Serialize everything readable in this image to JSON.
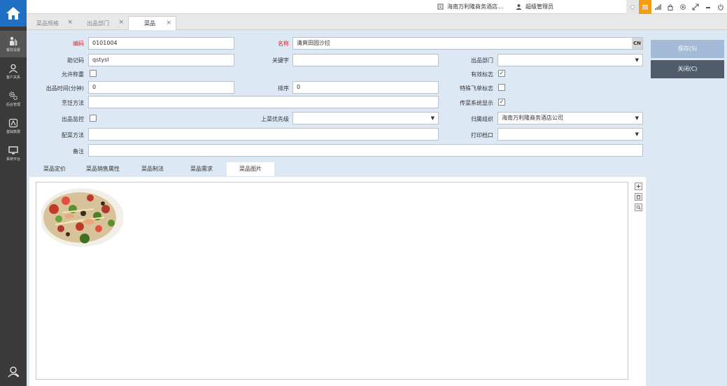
{
  "sidebar": {
    "items": [
      {
        "label": "餐饮设置",
        "icon": "chef-icon"
      },
      {
        "label": "客户关系",
        "icon": "user-icon"
      },
      {
        "label": "后台管理",
        "icon": "gears-icon"
      },
      {
        "label": "基础数据",
        "icon": "database-icon"
      },
      {
        "label": "系统平台",
        "icon": "monitor-icon"
      }
    ]
  },
  "topbar": {
    "hotel": "海南万利隆商务酒店...",
    "user": "超级管理员"
  },
  "tabs": [
    {
      "label": "菜品规格"
    },
    {
      "label": "出品部门"
    },
    {
      "label": "菜品"
    }
  ],
  "form": {
    "code_label": "编码",
    "code_value": "0101004",
    "name_label": "名称",
    "name_value": "清爽田园沙拉",
    "name_badge": "CN",
    "mnemonic_label": "助记码",
    "mnemonic_value": "qstysl",
    "keyword_label": "关键字",
    "keyword_value": "",
    "dept_label": "出品部门",
    "dept_value": "",
    "allow_weigh_label": "允许称重",
    "allow_weigh": false,
    "valid_label": "有效标志",
    "valid": true,
    "time_label": "出品时间(分钟)",
    "time_value": "0",
    "sort_label": "排序",
    "sort_value": "0",
    "special_label": "特殊飞单标志",
    "special": false,
    "cook_label": "烹饪方法",
    "cook_value": "",
    "pass_label": "传菜系统显示",
    "pass": true,
    "monitor_label": "出品监控",
    "monitor": false,
    "priority_label": "上菜优先级",
    "priority_value": "",
    "org_label": "归属组织",
    "org_value": "海南万利隆商务酒店公司",
    "mix_label": "配菜方法",
    "mix_value": "",
    "print_label": "打印档口",
    "print_value": "",
    "note_label": "备注",
    "note_value": ""
  },
  "subtabs": [
    {
      "label": "菜品定价"
    },
    {
      "label": "菜品销售属性"
    },
    {
      "label": "菜品制法"
    },
    {
      "label": "菜品需求"
    },
    {
      "label": "菜品图片"
    }
  ],
  "buttons": {
    "save": "保存(S)",
    "close": "关闭(C)"
  },
  "colors": {
    "sidebar": "#3a3a3a",
    "home": "#1f6fc4",
    "required": "#e02020",
    "save_button": "#a3bbd8",
    "close_button": "#505c6b",
    "accent_orange": "#f39c12"
  }
}
